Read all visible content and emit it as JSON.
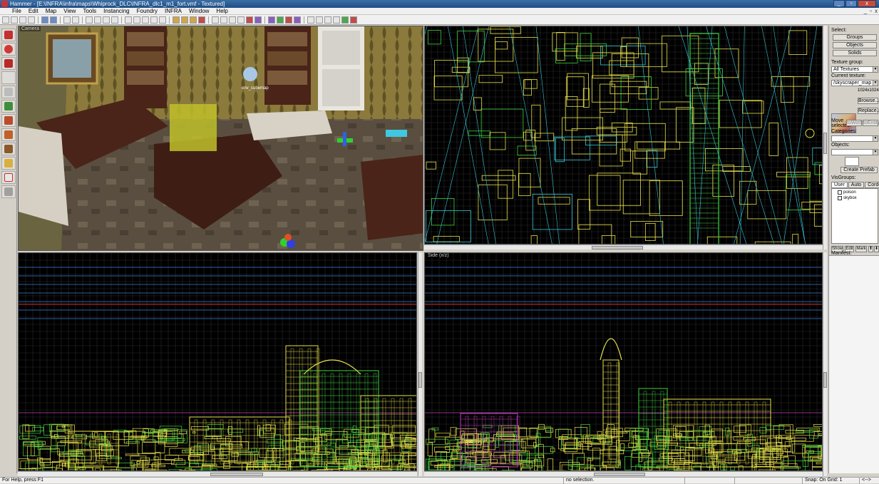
{
  "window": {
    "title": "Hammer - [E:\\INFRA\\infra\\maps\\Whiprock_DLC\\INFRA_dlc1_m1_fort.vmf - Textured]",
    "min_glyph": "_",
    "max_glyph": "▫",
    "close_glyph": "x"
  },
  "menu": {
    "items": [
      "File",
      "Edit",
      "Map",
      "View",
      "Tools",
      "Instancing",
      "Foundry",
      "INFRA",
      "Window",
      "Help"
    ],
    "mdi_controls": [
      "_",
      "▫",
      "x"
    ]
  },
  "viewports": {
    "camera_label": "Camera",
    "camera_overlay": "env_cubemap",
    "top_label": "",
    "front_label": "",
    "side_label": "Side (x/z)"
  },
  "right_panel": {
    "select_label": "Select:",
    "groups_btn": "Groups",
    "objects_btn": "Objects",
    "solids_btn": "Solids",
    "texture_group_label": "Texture group:",
    "texture_group_value": "All Textures",
    "current_texture_label": "Current texture:",
    "current_texture_value": "/skyscraper_map",
    "texture_size": "1024x1024",
    "browse_btn": "Browse...",
    "replace_btn": "Replace...",
    "move_selected_label": "Move selected:",
    "to_world_btn": "toWorld",
    "to_entity_btn": "toEntity",
    "categories_label": "Categories:",
    "objects_label": "Objects:",
    "create_prefab_btn": "Create Prefab",
    "visgroups_label": "VisGroups:",
    "tabs": [
      "User",
      "Auto",
      "Cordon"
    ],
    "visgroups": [
      "poison",
      "skybox"
    ],
    "show_btn": "Show",
    "edit_btn": "Edit",
    "mark_btn": "Mark",
    "up_btn": "⬆",
    "down_btn": "⬇",
    "manifest_label": "Manifest:"
  },
  "status": {
    "help": "For Help, press F1",
    "selection": "no selection.",
    "snap": "Snap: On Grid: 1",
    "cursor": "<-->"
  },
  "colors": {
    "grid": "#2b2b2b",
    "blue_line": "#3a7ad8",
    "red_line": "#d03030",
    "yellow": "#e8e04a",
    "green": "#3fd23f",
    "cyan": "#39c6d6",
    "magenta": "#c040c0"
  }
}
